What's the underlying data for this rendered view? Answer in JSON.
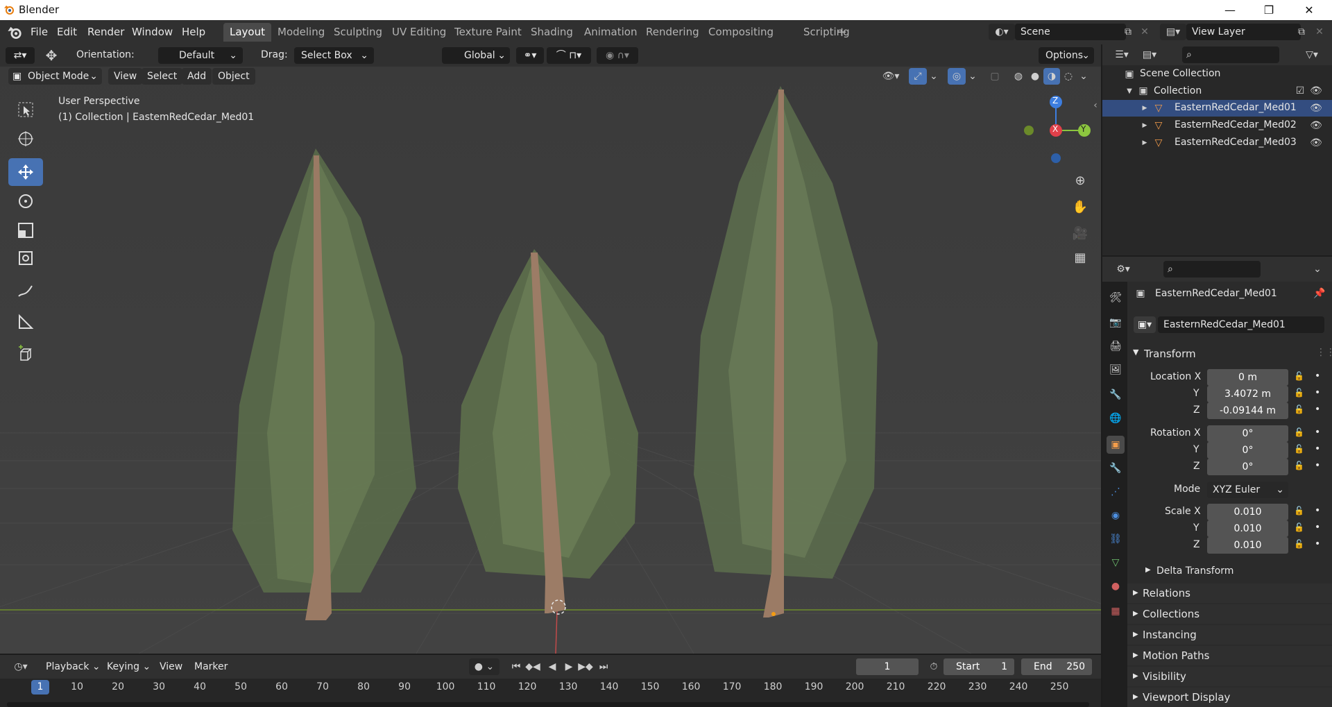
{
  "window": {
    "title": "Blender",
    "controls": {
      "minimize": "—",
      "maximize": "❐",
      "close": "✕"
    }
  },
  "menu": [
    "File",
    "Edit",
    "Render",
    "Window",
    "Help"
  ],
  "workspaces": [
    "Layout",
    "Modeling",
    "Sculpting",
    "UV Editing",
    "Texture Paint",
    "Shading",
    "Animation",
    "Rendering",
    "Compositing",
    "Scripting"
  ],
  "add_workspace": "+",
  "scene": {
    "name": "Scene",
    "view_layer": "View Layer"
  },
  "tool_header": {
    "orientation_label": "Orientation:",
    "orientation_value": "Default",
    "drag_label": "Drag:",
    "drag_value": "Select Box",
    "transform_orientation": "Global",
    "options": "Options"
  },
  "viewport_header": {
    "mode": "Object Mode",
    "menus": [
      "View",
      "Select",
      "Add",
      "Object"
    ]
  },
  "viewport": {
    "perspective": "User Perspective",
    "active": "(1) Collection | EastemRedCedar_Med01",
    "gizmo": {
      "z": "Z",
      "x": "X",
      "y": "Y"
    }
  },
  "outliner": {
    "root": "Scene Collection",
    "collection": "Collection",
    "items": [
      "EasternRedCedar_Med01",
      "EasternRedCedar_Med02",
      "EasternRedCedar_Med03"
    ]
  },
  "properties": {
    "object_name": "EasternRedCedar_Med01",
    "data_name": "EasternRedCedar_Med01",
    "transform_header": "Transform",
    "location_label": "Location X",
    "location": [
      "0 m",
      "3.4072 m",
      "-0.09144 m"
    ],
    "rotation_label": "Rotation X",
    "rotation": [
      "0°",
      "0°",
      "0°"
    ],
    "y_label": "Y",
    "z_label": "Z",
    "mode_label": "Mode",
    "mode_value": "XYZ Euler",
    "scale_label": "Scale X",
    "scale": [
      "0.010",
      "0.010",
      "0.010"
    ],
    "delta": "Delta Transform",
    "panels": [
      "Relations",
      "Collections",
      "Instancing",
      "Motion Paths",
      "Visibility",
      "Viewport Display"
    ]
  },
  "timeline": {
    "menus": [
      "Playback",
      "Keying",
      "View",
      "Marker"
    ],
    "current_frame": "1",
    "start_label": "Start",
    "start": "1",
    "end_label": "End",
    "end": "250",
    "ruler": [
      "1",
      "10",
      "20",
      "30",
      "40",
      "50",
      "60",
      "70",
      "80",
      "90",
      "100",
      "110",
      "120",
      "130",
      "140",
      "150",
      "160",
      "170",
      "180",
      "190",
      "200",
      "210",
      "220",
      "230",
      "240",
      "250"
    ]
  },
  "colors": {
    "accent": "#4772b3",
    "viewport_bg": "#3d3d3d",
    "x_axis": "#e0404a",
    "y_axis": "#8cc63f",
    "z_axis": "#3d7ee0",
    "panel": "#303030"
  }
}
